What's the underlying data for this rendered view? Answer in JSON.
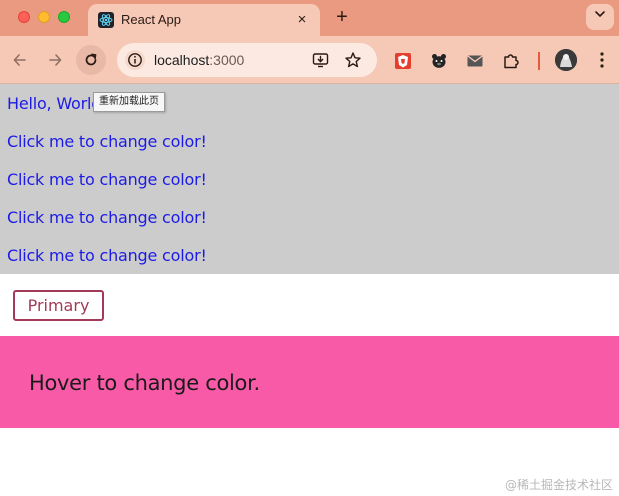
{
  "browser": {
    "tab": {
      "title": "React App",
      "close_glyph": "×"
    },
    "new_tab_glyph": "+",
    "tab_search_glyph": "⌄",
    "address": {
      "host": "localhost",
      "port": ":3000"
    },
    "reload_tooltip": "重新加载此页",
    "colors": {
      "tabstrip": "#e99a80",
      "toolbar": "#f6c9b7"
    }
  },
  "page": {
    "lines": [
      "Hello, World!",
      "Click me to change color!",
      "Click me to change color!",
      "Click me to change color!",
      "Click me to change color!"
    ],
    "primary_button": "Primary",
    "hover_text": "Hover to change color.",
    "colors": {
      "gray_bg": "#cccccc",
      "link_text": "#1c1be6",
      "button_border": "#a33a57",
      "hover_bg": "#f95aa7"
    }
  },
  "watermark": "@稀土掘金技术社区"
}
